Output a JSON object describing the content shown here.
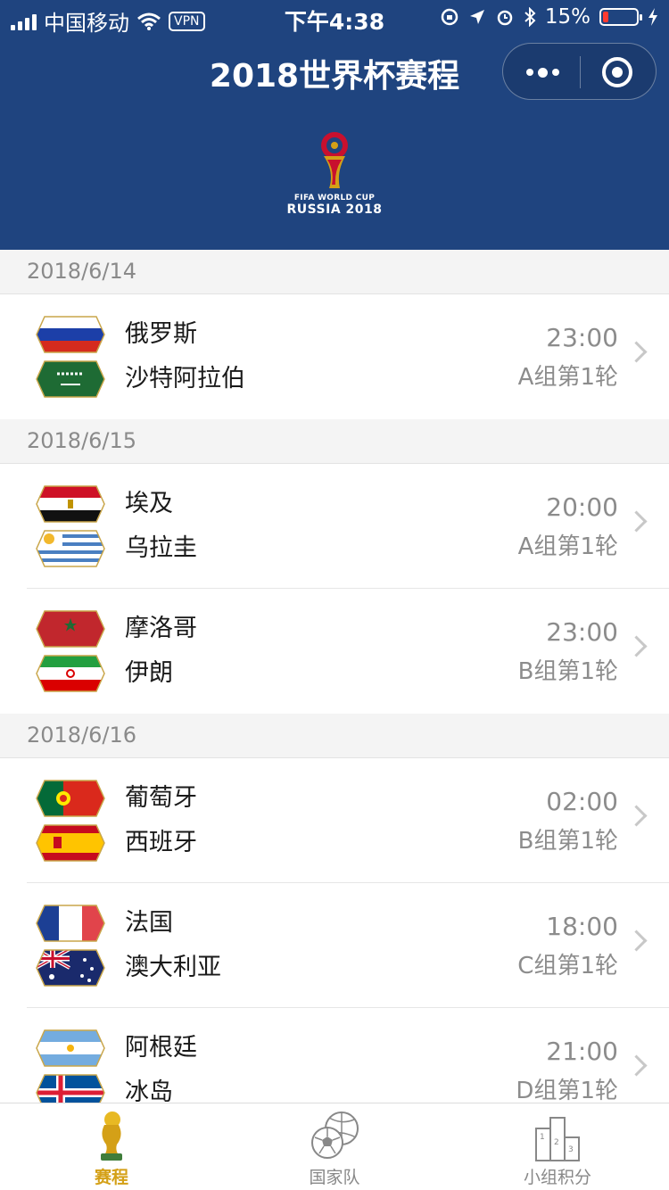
{
  "status_bar": {
    "carrier": "中国移动",
    "vpn": "VPN",
    "time": "下午4:38",
    "battery": "15%"
  },
  "header": {
    "title": "2018世界杯赛程",
    "logo_line1": "FIFA WORLD CUP",
    "logo_line2": "RUSSIA 2018"
  },
  "colors": {
    "header_bg": "#1f447f",
    "accent_gold": "#d4a017",
    "battery_low": "#ff3b30"
  },
  "days": [
    {
      "date": "2018/6/14",
      "matches": [
        {
          "team1": "俄罗斯",
          "team2": "沙特阿拉伯",
          "time": "23:00",
          "group": "A组第1轮"
        }
      ]
    },
    {
      "date": "2018/6/15",
      "matches": [
        {
          "team1": "埃及",
          "team2": "乌拉圭",
          "time": "20:00",
          "group": "A组第1轮"
        },
        {
          "team1": "摩洛哥",
          "team2": "伊朗",
          "time": "23:00",
          "group": "B组第1轮"
        }
      ]
    },
    {
      "date": "2018/6/16",
      "matches": [
        {
          "team1": "葡萄牙",
          "team2": "西班牙",
          "time": "02:00",
          "group": "B组第1轮"
        },
        {
          "team1": "法国",
          "team2": "澳大利亚",
          "time": "18:00",
          "group": "C组第1轮"
        },
        {
          "team1": "阿根廷",
          "team2": "冰岛",
          "time": "21:00",
          "group": "D组第1轮"
        }
      ]
    }
  ],
  "tabs": [
    {
      "label": "赛程",
      "icon": "trophy-icon",
      "active": true
    },
    {
      "label": "国家队",
      "icon": "football-icon",
      "active": false
    },
    {
      "label": "小组积分",
      "icon": "podium-icon",
      "active": false
    }
  ]
}
